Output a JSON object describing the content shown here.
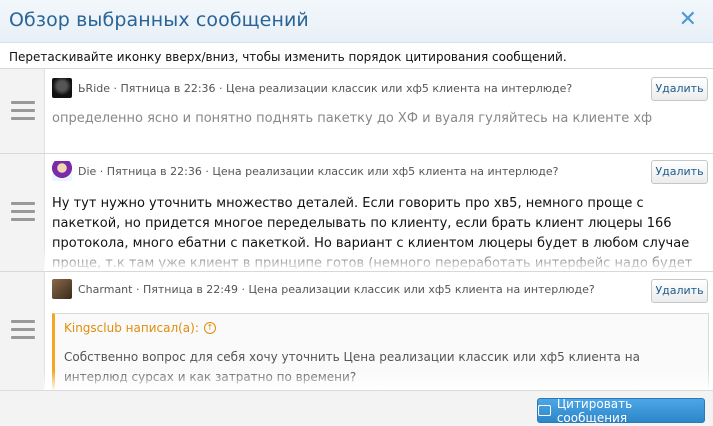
{
  "dialog": {
    "title": "Обзор выбранных сообщений",
    "close_glyph": "✕",
    "instruction": "Перетаскивайте иконку вверх/вниз, чтобы изменить порядок цитирования сообщений."
  },
  "messages": [
    {
      "author": "ЬRide",
      "time": "Пятница в 22:36",
      "thread": "Цена реализации классик или хф5 клиента на интерлюде?",
      "delete_label": "Удалить",
      "text": "определенно ясно и понятно поднять пакетку до ХФ и вуаля гуляйтесь на клиенте хф"
    },
    {
      "author": "Die",
      "time": "Пятница в 22:36",
      "thread": "Цена реализации классик или хф5 клиента на интерлюде?",
      "delete_label": "Удалить",
      "text": "Ну тут нужно уточнить множество деталей. Если говорить про хв5, немного проще с пакеткой, но придется многое переделывать по клиенту, если брать клиент люцеры 166 протокола, много ебатни с пакеткой. Но вариант с клиентом люцеры будет в любом случае проще, т.к там уже клиент в принципе готов (немного переработать интерфейс надо будет только)"
    },
    {
      "author": "Charmant",
      "time": "Пятница в 22:49",
      "thread": "Цена реализации классик или хф5 клиента на интерлюде?",
      "delete_label": "Удалить",
      "quote_author": "Kingsclub написал(а):",
      "quote_text": "Собственно вопрос для себя хочу уточнить Цена реализации классик или хф5 клиента на интерлюд сурсах и как затратно по времени?"
    }
  ],
  "footer": {
    "quote_button_label": "Цитировать сообщения"
  },
  "colors": {
    "title": "#2a6496",
    "accent": "#2d86c8",
    "quote_border": "#f5a623"
  }
}
